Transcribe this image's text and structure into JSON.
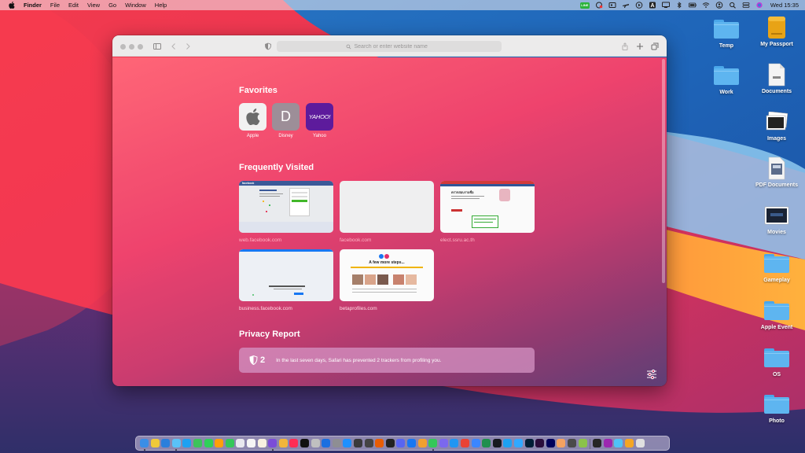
{
  "menubar": {
    "app_name": "Finder",
    "menus": [
      "File",
      "Edit",
      "View",
      "Go",
      "Window",
      "Help"
    ],
    "line_badge": "LINE",
    "input_source": "A",
    "clock": "Wed 15:35"
  },
  "safari": {
    "address_placeholder": "Search or enter website name",
    "favorites_title": "Favorites",
    "favorites": [
      {
        "label": "Apple",
        "tile": "apple-logo"
      },
      {
        "label": "Disney",
        "tile": "D"
      },
      {
        "label": "Yahoo",
        "tile": "YAHOO!"
      }
    ],
    "frequently_title": "Frequently Visited",
    "frequently": [
      {
        "url": "web.facebook.com"
      },
      {
        "url": "facebook.com"
      },
      {
        "url": "elect.ssru.ac.th"
      },
      {
        "url": "business.facebook.com"
      },
      {
        "url": "betaprofiles.com"
      }
    ],
    "thumb_text": {
      "fb_logo": "facebook",
      "ssru_heading": "ตรวจสอบรายชื่อ",
      "beta_heading": "A few more steps..."
    },
    "privacy_title": "Privacy Report",
    "privacy_count": "2",
    "privacy_message": "In the last seven days, Safari has prevented 2 trackers from profiling you."
  },
  "desktop_icons": [
    {
      "label": "Temp",
      "type": "folder"
    },
    {
      "label": "My Passport",
      "type": "drive"
    },
    {
      "label": "Work",
      "type": "folder"
    },
    {
      "label": "Documents",
      "type": "document"
    },
    {
      "label": "Images",
      "type": "photo-stack"
    },
    {
      "label": "PDF Documents",
      "type": "pdf"
    },
    {
      "label": "Movies",
      "type": "movie"
    },
    {
      "label": "Gameplay",
      "type": "folder"
    },
    {
      "label": "Apple Event",
      "type": "folder"
    },
    {
      "label": "OS",
      "type": "folder"
    },
    {
      "label": "Photo",
      "type": "folder"
    }
  ],
  "dock_colors": [
    "#3a8ee6",
    "#f0c93a",
    "#2a7fdc",
    "#5ac2f7",
    "#1da1f2",
    "#3cc45a",
    "#2fd158",
    "#ff9f0a",
    "#34c759",
    "#e8e8ee",
    "#f5f5f5",
    "#f7f1e0",
    "#7b4dd8",
    "#f2b63a",
    "#ff2d55",
    "#111111",
    "#c0c0c0",
    "#1b6fe0",
    "#8e8e93",
    "#1e90ff",
    "#3a3a3c",
    "#444444",
    "#e85d04",
    "#222222",
    "#5865f2",
    "#1877f2",
    "#f0a030",
    "#34c759",
    "#7b68ee",
    "#2196f3",
    "#ea4335",
    "#3a86ff",
    "#1f8f4e",
    "#171a21",
    "#1da1f2",
    "#31a8ff",
    "#001e36",
    "#2a0d3c",
    "#00005b",
    "#f4a261",
    "#4a4a4a",
    "#8bc34a",
    "#262626",
    "#9c27b0",
    "#4fc3f7",
    "#f5a623",
    "#e0e0e0"
  ],
  "colors": {
    "accent": "#ee3864",
    "folder": "#5eb5f0",
    "yahoo": "#5d1b9c"
  }
}
